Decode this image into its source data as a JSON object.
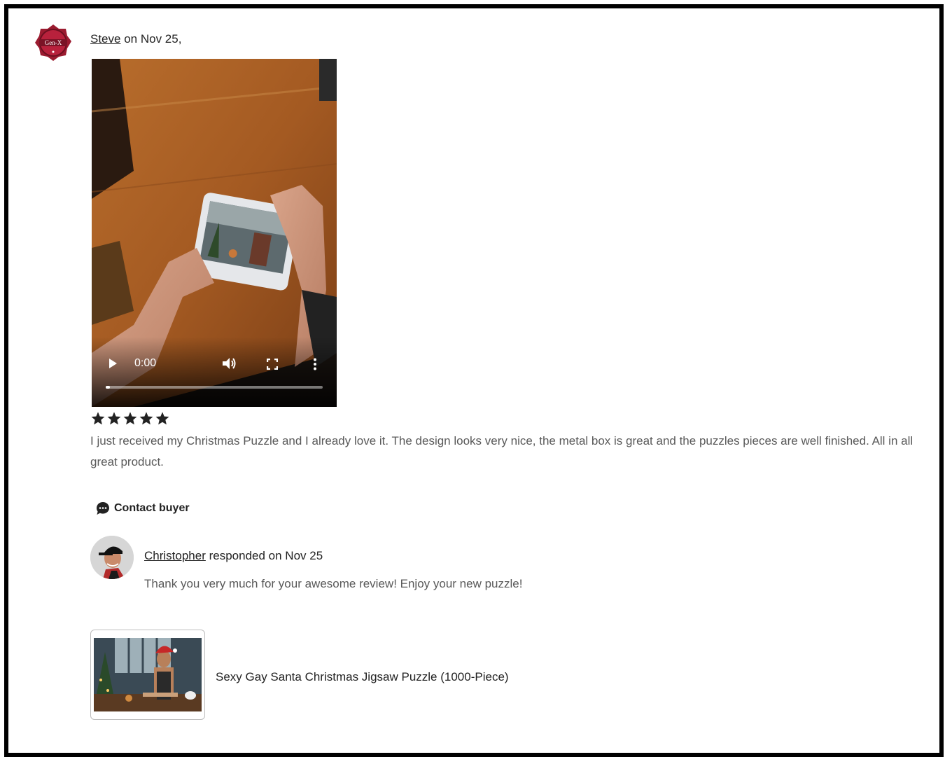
{
  "review": {
    "reviewer_name": "Steve",
    "date_text": " on Nov 25,",
    "avatar_text": "Gen-X",
    "rating": 5,
    "rating_max": 5,
    "text": "I just received my Christmas Puzzle and I already love it. The design looks very nice, the metal box is great and the puzzles pieces are well finished. All in all great product."
  },
  "video": {
    "time": "0:00",
    "progress_fraction": 0.02
  },
  "actions": {
    "contact_label": "Contact buyer"
  },
  "response": {
    "seller_name": "Christopher",
    "date_text": " responded on Nov 25",
    "text": "Thank you very much for your awesome review! Enjoy your new puzzle!"
  },
  "product": {
    "title": "Sexy Gay Santa Christmas Jigsaw Puzzle (1000-Piece)"
  },
  "colors": {
    "text_primary": "#222222",
    "text_secondary": "#595959",
    "star": "#222222",
    "badge_red": "#9b1b30"
  }
}
